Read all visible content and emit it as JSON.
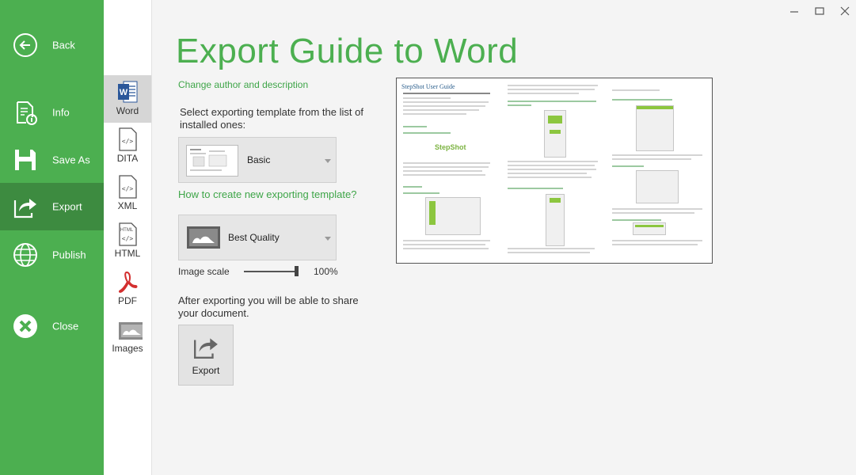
{
  "window": {
    "minimize_icon": "minimize-icon",
    "maximize_icon": "maximize-icon",
    "close_icon": "close-icon"
  },
  "sidebar": {
    "accent": "#4caf50",
    "items": [
      {
        "label": "Back",
        "icon": "back-arrow-icon"
      },
      {
        "label": "Info",
        "icon": "info-document-icon"
      },
      {
        "label": "Save As",
        "icon": "floppy-disk-icon"
      },
      {
        "label": "Export",
        "icon": "export-icon",
        "active": true
      },
      {
        "label": "Publish",
        "icon": "globe-icon"
      },
      {
        "label": "Close",
        "icon": "close-circle-icon"
      }
    ]
  },
  "formats": [
    {
      "label": "Word",
      "icon": "word-icon",
      "active": true
    },
    {
      "label": "DITA",
      "icon": "dita-file-icon"
    },
    {
      "label": "XML",
      "icon": "xml-file-icon"
    },
    {
      "label": "HTML",
      "icon": "html-file-icon"
    },
    {
      "label": "PDF",
      "icon": "pdf-icon"
    },
    {
      "label": "Images",
      "icon": "images-icon"
    }
  ],
  "main": {
    "title": "Export Guide to Word",
    "change_author_link": "Change author and description",
    "template_prompt": "Select exporting template from the list of installed ones:",
    "template_selected": "Basic",
    "how_to_link": "How to create new exporting template?",
    "quality_selected": "Best Quality",
    "image_scale_label": "Image scale",
    "image_scale_value": "100%",
    "image_scale_fraction": 1.0,
    "after_export_text": "After exporting you will be able to share your document.",
    "export_button": "Export"
  },
  "preview": {
    "heading": "StepShot User Guide",
    "logo_text": "StepShot"
  }
}
